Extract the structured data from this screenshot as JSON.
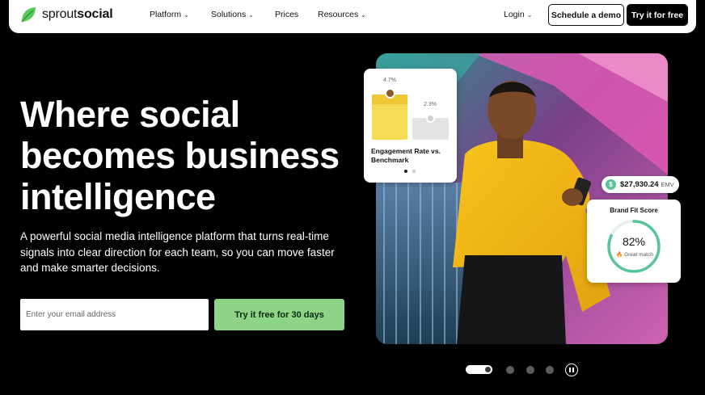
{
  "brand": {
    "name_light": "sprout",
    "name_bold": "social",
    "accent": "#59cb59"
  },
  "nav": {
    "items": [
      {
        "label": "Platform",
        "has_dropdown": true
      },
      {
        "label": "Solutions",
        "has_dropdown": true
      },
      {
        "label": "Prices",
        "has_dropdown": false
      },
      {
        "label": "Resources",
        "has_dropdown": true
      }
    ],
    "login": {
      "label": "Login",
      "has_dropdown": true
    },
    "demo_label": "Schedule a demo",
    "try_label": "Try it for free"
  },
  "hero": {
    "headline_lines": [
      "Where social",
      "becomes business",
      "intelligence"
    ],
    "subtext": "A powerful social media intelligence platform that turns real-time signals into clear direction for each team, so you can move faster and make smarter decisions.",
    "email_placeholder": "Enter your email address",
    "cta_label": "Try it free for 30 days",
    "cta_color": "#8ed486"
  },
  "cards": {
    "engagement": {
      "value_primary": "4.7%",
      "value_benchmark": "2.3%",
      "label": "Engagement Rate vs. Benchmark"
    },
    "emv": {
      "value": "$27,930.24",
      "unit": "EMV"
    },
    "brand_fit": {
      "title": "Brand Fit Score",
      "value": "82%",
      "value_fraction": 0.82,
      "sub": "Great match",
      "ring_color": "#59c39a"
    }
  },
  "carousel": {
    "slide_count": 4,
    "active_index": 0
  }
}
